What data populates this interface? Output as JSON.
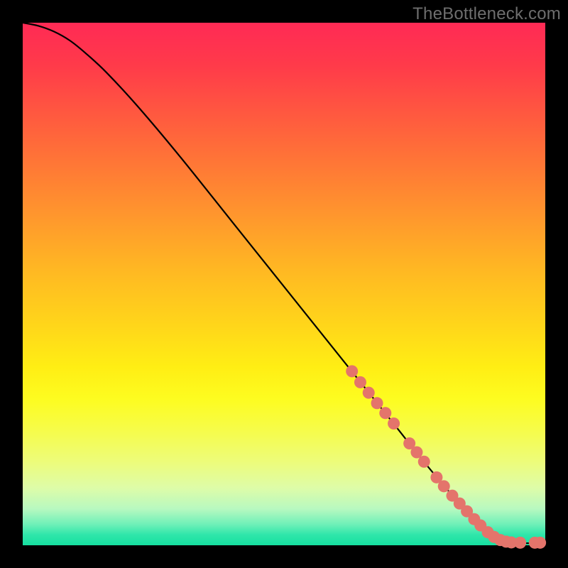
{
  "watermark": "TheBottleneck.com",
  "chart_data": {
    "type": "line",
    "title": "",
    "xlabel": "",
    "ylabel": "",
    "xlim": [
      0,
      100
    ],
    "ylim": [
      0,
      100
    ],
    "series": [
      {
        "name": "curve",
        "x": [
          0,
          3,
          6,
          9,
          12,
          16,
          22,
          30,
          40,
          50,
          60,
          70,
          78,
          85,
          90,
          95,
          100
        ],
        "y": [
          100,
          99.4,
          98.3,
          96.6,
          94.2,
          90.5,
          84,
          74.5,
          62,
          49.5,
          37,
          24.5,
          14.5,
          6.5,
          2,
          0.5,
          0.5
        ]
      }
    ],
    "highlight_range_x": [
      63,
      100
    ],
    "markers": {
      "name": "highlight-points",
      "points": [
        {
          "x": 63,
          "y": 33.3
        },
        {
          "x": 64.6,
          "y": 31.2
        },
        {
          "x": 66.2,
          "y": 29.2
        },
        {
          "x": 67.8,
          "y": 27.2
        },
        {
          "x": 69.4,
          "y": 25.3
        },
        {
          "x": 71.0,
          "y": 23.3
        },
        {
          "x": 74.0,
          "y": 19.5
        },
        {
          "x": 75.4,
          "y": 17.8
        },
        {
          "x": 76.8,
          "y": 16.0
        },
        {
          "x": 79.2,
          "y": 13.0
        },
        {
          "x": 80.6,
          "y": 11.3
        },
        {
          "x": 82.2,
          "y": 9.5
        },
        {
          "x": 83.6,
          "y": 8.0
        },
        {
          "x": 85.0,
          "y": 6.5
        },
        {
          "x": 86.4,
          "y": 5.0
        },
        {
          "x": 87.6,
          "y": 3.8
        },
        {
          "x": 89.0,
          "y": 2.5
        },
        {
          "x": 90.2,
          "y": 1.6
        },
        {
          "x": 91.4,
          "y": 1.0
        },
        {
          "x": 92.5,
          "y": 0.7
        },
        {
          "x": 93.5,
          "y": 0.55
        },
        {
          "x": 95.2,
          "y": 0.5
        },
        {
          "x": 98.0,
          "y": 0.5
        },
        {
          "x": 99.0,
          "y": 0.5
        }
      ]
    },
    "colors": {
      "curve": "#000000",
      "markers": "#e4746b",
      "gradient_top": "#ff2a55",
      "gradient_bottom": "#16dfa0"
    }
  }
}
